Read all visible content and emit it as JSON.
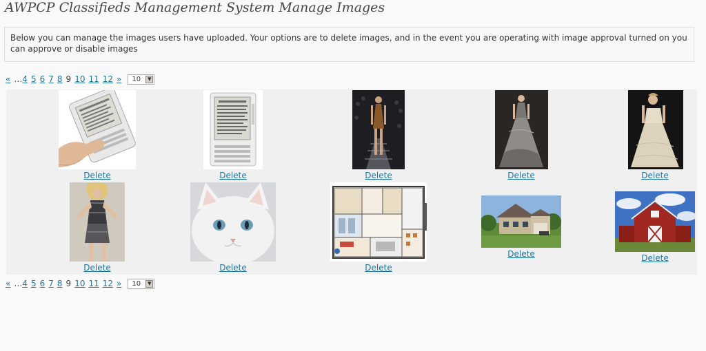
{
  "header": {
    "title": "AWPCP Classifieds Management System Manage Images"
  },
  "notice": {
    "text": "Below you can manage the images users have uploaded. Your options are to delete images, and in the event you are operating with image approval turned on you can approve or disable images"
  },
  "pagination": {
    "prev": "«",
    "ellipsis": "…",
    "pages": [
      "4",
      "5",
      "6",
      "7",
      "8",
      "9",
      "10",
      "11",
      "12"
    ],
    "current": "9",
    "next": "»",
    "per_page": "10"
  },
  "images": [
    {
      "alt": "e-reader device held in hand",
      "delete_label": "Delete"
    },
    {
      "alt": "e-reader device",
      "delete_label": "Delete"
    },
    {
      "alt": "model on runway in short dress",
      "delete_label": "Delete"
    },
    {
      "alt": "model in grey ball gown",
      "delete_label": "Delete"
    },
    {
      "alt": "model in ivory gown",
      "delete_label": "Delete"
    },
    {
      "alt": "model in metallic outfit",
      "delete_label": "Delete"
    },
    {
      "alt": "white cat",
      "delete_label": "Delete"
    },
    {
      "alt": "apartment floor plan",
      "delete_label": "Delete"
    },
    {
      "alt": "suburban house",
      "delete_label": "Delete"
    },
    {
      "alt": "red barn under blue sky",
      "delete_label": "Delete"
    }
  ],
  "colors": {
    "link": "#21759b",
    "title": "#464646",
    "grid_bg": "#f0f0f0"
  }
}
